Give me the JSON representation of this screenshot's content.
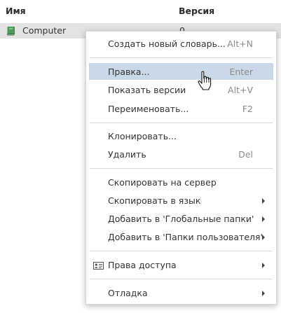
{
  "table": {
    "columns": {
      "name": "Имя",
      "version": "Версия"
    },
    "rows": [
      {
        "icon": "book-icon",
        "name": "Computer",
        "version": "0"
      }
    ]
  },
  "context_menu": {
    "items": [
      {
        "label": "Создать новый словарь...",
        "shortcut": "Alt+N"
      },
      {
        "label": "Правка...",
        "shortcut": "Enter",
        "highlighted": true
      },
      {
        "label": "Показать версии",
        "shortcut": "Alt+V"
      },
      {
        "label": "Переименовать...",
        "shortcut": "F2"
      },
      {
        "label": "Клонировать...",
        "shortcut": ""
      },
      {
        "label": "Удалить",
        "shortcut": "Del"
      },
      {
        "label": "Скопировать на сервер",
        "shortcut": ""
      },
      {
        "label": "Скопировать в язык",
        "submenu": true
      },
      {
        "label": "Добавить в 'Глобальные папки'",
        "submenu": true
      },
      {
        "label": "Добавить в 'Папки пользователя'",
        "submenu": true
      },
      {
        "label": "Права доступа",
        "submenu": true,
        "icon": "id-card-icon"
      },
      {
        "label": "Отладка",
        "submenu": true
      }
    ]
  },
  "colors": {
    "selected_row": "#e3e3e3",
    "menu_highlight": "#c9d9e7",
    "book_icon": "#4e9a5c"
  }
}
